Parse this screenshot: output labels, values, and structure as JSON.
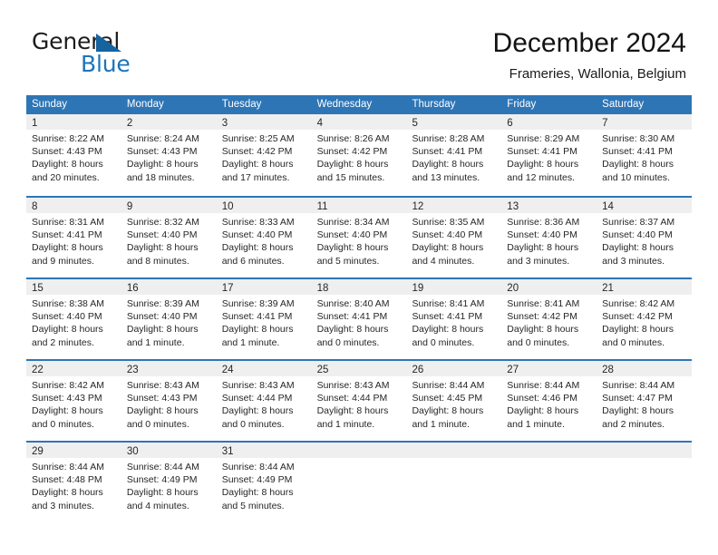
{
  "brand": {
    "name_part1": "General",
    "name_part2": "Blue",
    "triangle_color": "#15639f",
    "blue_color": "#1b75bb"
  },
  "header": {
    "title": "December 2024",
    "subtitle": "Frameries, Wallonia, Belgium"
  },
  "theme": {
    "header_blue": "#2e75b6",
    "daynum_band": "#efeff0",
    "text": "#262626"
  },
  "weekdays": [
    "Sunday",
    "Monday",
    "Tuesday",
    "Wednesday",
    "Thursday",
    "Friday",
    "Saturday"
  ],
  "weeks": [
    [
      {
        "day": "1",
        "sunrise": "Sunrise: 8:22 AM",
        "sunset": "Sunset: 4:43 PM",
        "daylight1": "Daylight: 8 hours",
        "daylight2": "and 20 minutes."
      },
      {
        "day": "2",
        "sunrise": "Sunrise: 8:24 AM",
        "sunset": "Sunset: 4:43 PM",
        "daylight1": "Daylight: 8 hours",
        "daylight2": "and 18 minutes."
      },
      {
        "day": "3",
        "sunrise": "Sunrise: 8:25 AM",
        "sunset": "Sunset: 4:42 PM",
        "daylight1": "Daylight: 8 hours",
        "daylight2": "and 17 minutes."
      },
      {
        "day": "4",
        "sunrise": "Sunrise: 8:26 AM",
        "sunset": "Sunset: 4:42 PM",
        "daylight1": "Daylight: 8 hours",
        "daylight2": "and 15 minutes."
      },
      {
        "day": "5",
        "sunrise": "Sunrise: 8:28 AM",
        "sunset": "Sunset: 4:41 PM",
        "daylight1": "Daylight: 8 hours",
        "daylight2": "and 13 minutes."
      },
      {
        "day": "6",
        "sunrise": "Sunrise: 8:29 AM",
        "sunset": "Sunset: 4:41 PM",
        "daylight1": "Daylight: 8 hours",
        "daylight2": "and 12 minutes."
      },
      {
        "day": "7",
        "sunrise": "Sunrise: 8:30 AM",
        "sunset": "Sunset: 4:41 PM",
        "daylight1": "Daylight: 8 hours",
        "daylight2": "and 10 minutes."
      }
    ],
    [
      {
        "day": "8",
        "sunrise": "Sunrise: 8:31 AM",
        "sunset": "Sunset: 4:41 PM",
        "daylight1": "Daylight: 8 hours",
        "daylight2": "and 9 minutes."
      },
      {
        "day": "9",
        "sunrise": "Sunrise: 8:32 AM",
        "sunset": "Sunset: 4:40 PM",
        "daylight1": "Daylight: 8 hours",
        "daylight2": "and 8 minutes."
      },
      {
        "day": "10",
        "sunrise": "Sunrise: 8:33 AM",
        "sunset": "Sunset: 4:40 PM",
        "daylight1": "Daylight: 8 hours",
        "daylight2": "and 6 minutes."
      },
      {
        "day": "11",
        "sunrise": "Sunrise: 8:34 AM",
        "sunset": "Sunset: 4:40 PM",
        "daylight1": "Daylight: 8 hours",
        "daylight2": "and 5 minutes."
      },
      {
        "day": "12",
        "sunrise": "Sunrise: 8:35 AM",
        "sunset": "Sunset: 4:40 PM",
        "daylight1": "Daylight: 8 hours",
        "daylight2": "and 4 minutes."
      },
      {
        "day": "13",
        "sunrise": "Sunrise: 8:36 AM",
        "sunset": "Sunset: 4:40 PM",
        "daylight1": "Daylight: 8 hours",
        "daylight2": "and 3 minutes."
      },
      {
        "day": "14",
        "sunrise": "Sunrise: 8:37 AM",
        "sunset": "Sunset: 4:40 PM",
        "daylight1": "Daylight: 8 hours",
        "daylight2": "and 3 minutes."
      }
    ],
    [
      {
        "day": "15",
        "sunrise": "Sunrise: 8:38 AM",
        "sunset": "Sunset: 4:40 PM",
        "daylight1": "Daylight: 8 hours",
        "daylight2": "and 2 minutes."
      },
      {
        "day": "16",
        "sunrise": "Sunrise: 8:39 AM",
        "sunset": "Sunset: 4:40 PM",
        "daylight1": "Daylight: 8 hours",
        "daylight2": "and 1 minute."
      },
      {
        "day": "17",
        "sunrise": "Sunrise: 8:39 AM",
        "sunset": "Sunset: 4:41 PM",
        "daylight1": "Daylight: 8 hours",
        "daylight2": "and 1 minute."
      },
      {
        "day": "18",
        "sunrise": "Sunrise: 8:40 AM",
        "sunset": "Sunset: 4:41 PM",
        "daylight1": "Daylight: 8 hours",
        "daylight2": "and 0 minutes."
      },
      {
        "day": "19",
        "sunrise": "Sunrise: 8:41 AM",
        "sunset": "Sunset: 4:41 PM",
        "daylight1": "Daylight: 8 hours",
        "daylight2": "and 0 minutes."
      },
      {
        "day": "20",
        "sunrise": "Sunrise: 8:41 AM",
        "sunset": "Sunset: 4:42 PM",
        "daylight1": "Daylight: 8 hours",
        "daylight2": "and 0 minutes."
      },
      {
        "day": "21",
        "sunrise": "Sunrise: 8:42 AM",
        "sunset": "Sunset: 4:42 PM",
        "daylight1": "Daylight: 8 hours",
        "daylight2": "and 0 minutes."
      }
    ],
    [
      {
        "day": "22",
        "sunrise": "Sunrise: 8:42 AM",
        "sunset": "Sunset: 4:43 PM",
        "daylight1": "Daylight: 8 hours",
        "daylight2": "and 0 minutes."
      },
      {
        "day": "23",
        "sunrise": "Sunrise: 8:43 AM",
        "sunset": "Sunset: 4:43 PM",
        "daylight1": "Daylight: 8 hours",
        "daylight2": "and 0 minutes."
      },
      {
        "day": "24",
        "sunrise": "Sunrise: 8:43 AM",
        "sunset": "Sunset: 4:44 PM",
        "daylight1": "Daylight: 8 hours",
        "daylight2": "and 0 minutes."
      },
      {
        "day": "25",
        "sunrise": "Sunrise: 8:43 AM",
        "sunset": "Sunset: 4:44 PM",
        "daylight1": "Daylight: 8 hours",
        "daylight2": "and 1 minute."
      },
      {
        "day": "26",
        "sunrise": "Sunrise: 8:44 AM",
        "sunset": "Sunset: 4:45 PM",
        "daylight1": "Daylight: 8 hours",
        "daylight2": "and 1 minute."
      },
      {
        "day": "27",
        "sunrise": "Sunrise: 8:44 AM",
        "sunset": "Sunset: 4:46 PM",
        "daylight1": "Daylight: 8 hours",
        "daylight2": "and 1 minute."
      },
      {
        "day": "28",
        "sunrise": "Sunrise: 8:44 AM",
        "sunset": "Sunset: 4:47 PM",
        "daylight1": "Daylight: 8 hours",
        "daylight2": "and 2 minutes."
      }
    ],
    [
      {
        "day": "29",
        "sunrise": "Sunrise: 8:44 AM",
        "sunset": "Sunset: 4:48 PM",
        "daylight1": "Daylight: 8 hours",
        "daylight2": "and 3 minutes."
      },
      {
        "day": "30",
        "sunrise": "Sunrise: 8:44 AM",
        "sunset": "Sunset: 4:49 PM",
        "daylight1": "Daylight: 8 hours",
        "daylight2": "and 4 minutes."
      },
      {
        "day": "31",
        "sunrise": "Sunrise: 8:44 AM",
        "sunset": "Sunset: 4:49 PM",
        "daylight1": "Daylight: 8 hours",
        "daylight2": "and 5 minutes."
      },
      {
        "day": "",
        "sunrise": "",
        "sunset": "",
        "daylight1": "",
        "daylight2": ""
      },
      {
        "day": "",
        "sunrise": "",
        "sunset": "",
        "daylight1": "",
        "daylight2": ""
      },
      {
        "day": "",
        "sunrise": "",
        "sunset": "",
        "daylight1": "",
        "daylight2": ""
      },
      {
        "day": "",
        "sunrise": "",
        "sunset": "",
        "daylight1": "",
        "daylight2": ""
      }
    ]
  ]
}
